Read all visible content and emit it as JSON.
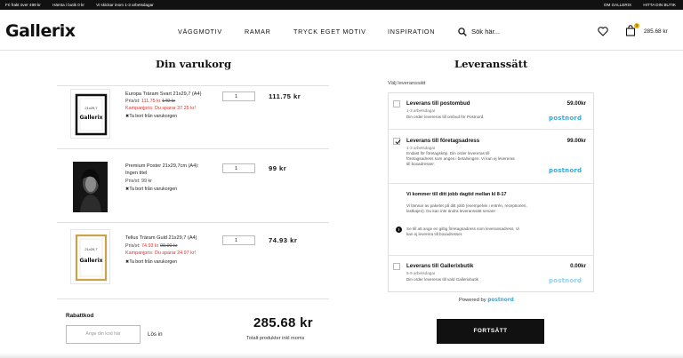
{
  "topbar": {
    "promos": [
      "Fri frakt över 499 kr",
      "Hämta i butik 0 kr",
      "Vi skickar inom 1-3 arbetsdagar"
    ],
    "about": "OM GALLERIX",
    "find_store": "HITTA DIN BUTIK"
  },
  "header": {
    "logo": "Gallerix",
    "nav": [
      "VÄGGMOTIV",
      "RAMAR",
      "TRYCK EGET MOTIV",
      "INSPIRATION"
    ],
    "search_placeholder": "Sök här...",
    "cart_count": "3",
    "cart_total": "285.68 kr"
  },
  "cart": {
    "title": "Din varukorg",
    "items": [
      {
        "name": "Europa Träram Svart 21x29,7 (A4)",
        "price_label": "Pris/st:",
        "price_now": "111.75 kr",
        "price_old": "149 kr",
        "campaign": "Kampanjpris: Du sparar 37.25 kr!",
        "remove": "Ta bort från varukorgen",
        "qty": "1",
        "total": "111.75 kr"
      },
      {
        "name_line1": "Premium Poster 21x29,7cm (A4):",
        "name_line2": "Ingen titel",
        "price": "Pris/st: 99 kr",
        "remove": "Ta bort från varukorgen",
        "qty": "1",
        "total": "99 kr"
      },
      {
        "name": "Tellus Träram Guld 21x29,7 (A4)",
        "price_label": "Pris/st:",
        "price_now": "74.93 kr",
        "price_old": "99.90 kr",
        "campaign": "Kampanjpris: Du sparar 24.97 kr!",
        "remove": "Ta bort från varukorgen",
        "qty": "1",
        "total": "74.93 kr"
      }
    ],
    "coupon_label": "Rabattkod",
    "coupon_placeholder": "Ange din kod här",
    "coupon_button": "Lös in",
    "grand_total": "285.68 kr",
    "grand_total_sub": "Totalt produkter inkl moms"
  },
  "delivery": {
    "title": "Leveranssätt",
    "choose": "Välj leveranssätt",
    "options": [
      {
        "title": "Leverans till postombud",
        "price": "59.00kr",
        "days": "1-3 arbetsdagar",
        "desc": "Din order levereras till ombud för Postnord.",
        "carrier": "postnord",
        "selected": false
      },
      {
        "title": "Leverans till företagsadress",
        "price": "99.00kr",
        "days": "1-3 arbetsdagar",
        "desc1": "Endast för företagsköp. Din order levereras till",
        "desc2": "företagsadress som anges i betalningen. Vi kan ej levereras",
        "desc3": "till boxadresser.",
        "carrier": "postnord",
        "selected": true
      },
      {
        "title": "Leverans till Gallerixbutik",
        "price": "0.00kr",
        "days": "5-9 arbetsdagar",
        "desc": "Din order levereras till vald Gallerixbutik",
        "carrier": "postnord",
        "selected": false
      }
    ],
    "info_title": "Vi kommer till ditt jobb dagtid mellan kl 8-17",
    "info_text1": "Vi lämnar av paketet på ditt jobb (exempelvis i entrén, receptionen,",
    "info_text2": "lastkajen). Du kan inte ändra leveranssätt senare",
    "warn_text1": "Se till att ange en giltig företagsadress som leveransadress. Vi",
    "warn_text2": "kan ej leverera till boxadresser.",
    "powered_by": "Powered by",
    "powered_brand": "postnord",
    "pay_button": "FORTSÄTT"
  },
  "colors": {
    "accent_red": "#dd3333",
    "postnord_blue": "#3aa8d8",
    "badge_yellow": "#e8b400",
    "button_black": "#111111"
  }
}
